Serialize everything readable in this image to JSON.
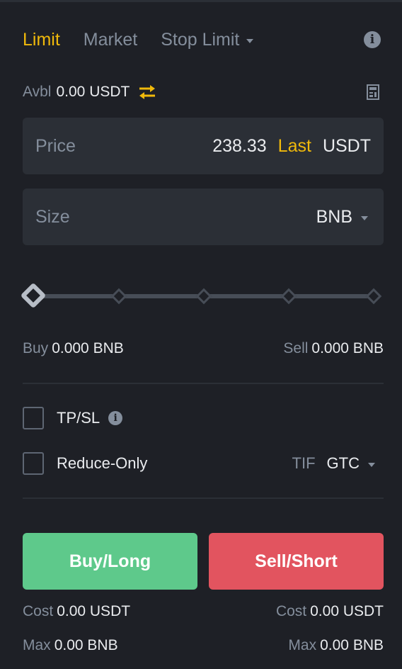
{
  "tabs": [
    {
      "label": "Limit",
      "active": true
    },
    {
      "label": "Market",
      "active": false
    },
    {
      "label": "Stop Limit",
      "active": false
    }
  ],
  "available": {
    "label": "Avbl",
    "value": "0.00 USDT"
  },
  "price": {
    "label": "Price",
    "value": "238.33",
    "last_label": "Last",
    "unit": "USDT"
  },
  "size": {
    "label": "Size",
    "value": "",
    "unit": "BNB"
  },
  "slider": {
    "percent": 0,
    "marks": [
      0,
      25,
      50,
      75,
      100
    ]
  },
  "buy_amount": {
    "label": "Buy",
    "value": "0.000 BNB"
  },
  "sell_amount": {
    "label": "Sell",
    "value": "0.000 BNB"
  },
  "tpsl": {
    "label": "TP/SL",
    "checked": false
  },
  "reduce_only": {
    "label": "Reduce-Only",
    "checked": false
  },
  "tif": {
    "label": "TIF",
    "value": "GTC"
  },
  "buttons": {
    "buy": "Buy/Long",
    "sell": "Sell/Short"
  },
  "buy_cost": {
    "label": "Cost",
    "value": "0.00 USDT"
  },
  "sell_cost": {
    "label": "Cost",
    "value": "0.00 USDT"
  },
  "buy_max": {
    "label": "Max",
    "value": "0.00 BNB"
  },
  "sell_max": {
    "label": "Max",
    "value": "0.00 BNB"
  },
  "colors": {
    "accent": "#f0b90b",
    "buy": "#5ec98b",
    "sell": "#e2545f",
    "background": "#1e2026",
    "input_bg": "#2b2f36",
    "muted_text": "#848e9c"
  },
  "icons": {
    "order_info": "info-icon",
    "transfer": "swap-arrows-icon",
    "calculator": "calculator-icon",
    "tpsl_info": "info-icon"
  }
}
